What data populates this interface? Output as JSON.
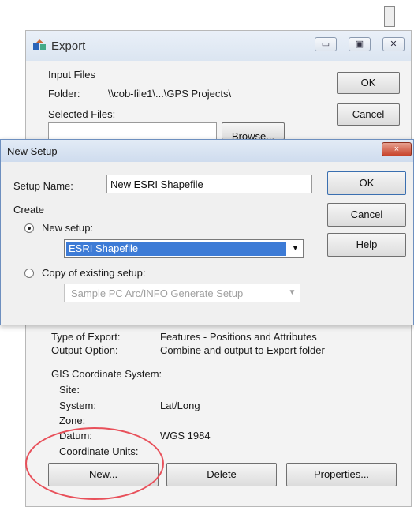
{
  "export_dialog": {
    "title": "Export",
    "input_files_label": "Input Files",
    "folder_label": "Folder:",
    "folder_value": "\\\\cob-file1\\...\\GPS Projects\\",
    "selected_files_label": "Selected Files:",
    "browse_label": "Browse...",
    "ok_label": "OK",
    "cancel_label": "Cancel",
    "type_of_export_label": "Type of Export:",
    "type_of_export_value": "Features - Positions and Attributes",
    "output_option_label": "Output Option:",
    "output_option_value": "Combine and output to Export folder",
    "gis_coord_label": "GIS Coordinate System:",
    "site_label": "Site:",
    "system_label": "System:",
    "system_value": "Lat/Long",
    "zone_label": "Zone:",
    "datum_label": "Datum:",
    "datum_value": "WGS 1984",
    "coord_units_label": "Coordinate Units:",
    "new_label": "New...",
    "delete_label": "Delete",
    "properties_label": "Properties..."
  },
  "new_setup_dialog": {
    "title": "New Setup",
    "close_label": "×",
    "setup_name_label": "Setup Name:",
    "setup_name_value": "New ESRI Shapefile",
    "create_label": "Create",
    "new_setup_label": "New setup:",
    "new_setup_selected": "ESRI Shapefile",
    "copy_existing_label": "Copy of existing setup:",
    "copy_existing_value": "Sample PC Arc/INFO Generate Setup",
    "ok_label": "OK",
    "cancel_label": "Cancel",
    "help_label": "Help"
  },
  "colors": {
    "highlight": "#3d7bd6",
    "annotation_circle": "#e8505a",
    "close_button": "#c8432b"
  }
}
